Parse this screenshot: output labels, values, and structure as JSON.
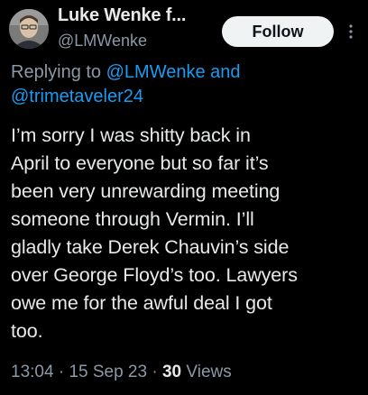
{
  "author": {
    "display_name": "Luke Wenke f...",
    "handle": "@LMWenke",
    "avatar": "profile-photo"
  },
  "follow_button": {
    "label": "Follow"
  },
  "more_icon": "more-vertical-dots-icon",
  "reply_context": {
    "prefix": "Replying to",
    "mention_1": "@LMWenke",
    "conjunction": "and",
    "mention_2": "@trimetaveler24"
  },
  "tweet": {
    "lines": [
      "I’m sorry I was shitty back in",
      "April to everyone but so far it’s",
      "been very unrewarding meeting",
      "someone through Vermin.  I’ll",
      "gladly take Derek Chauvin’s side",
      "over George Floyd’s too.  Lawyers",
      "owe me for the awful deal I got",
      "too."
    ]
  },
  "meta": {
    "time": "13:04",
    "separator": "·",
    "date": "15 Sep 23",
    "views_count": "30",
    "views_label": "Views"
  },
  "colors": {
    "background": "#000000",
    "text": "#e7e9ea",
    "secondary": "#8b98a5",
    "link": "#1d9bf0",
    "button_bg": "#eff3f4",
    "button_text": "#0f1419"
  }
}
